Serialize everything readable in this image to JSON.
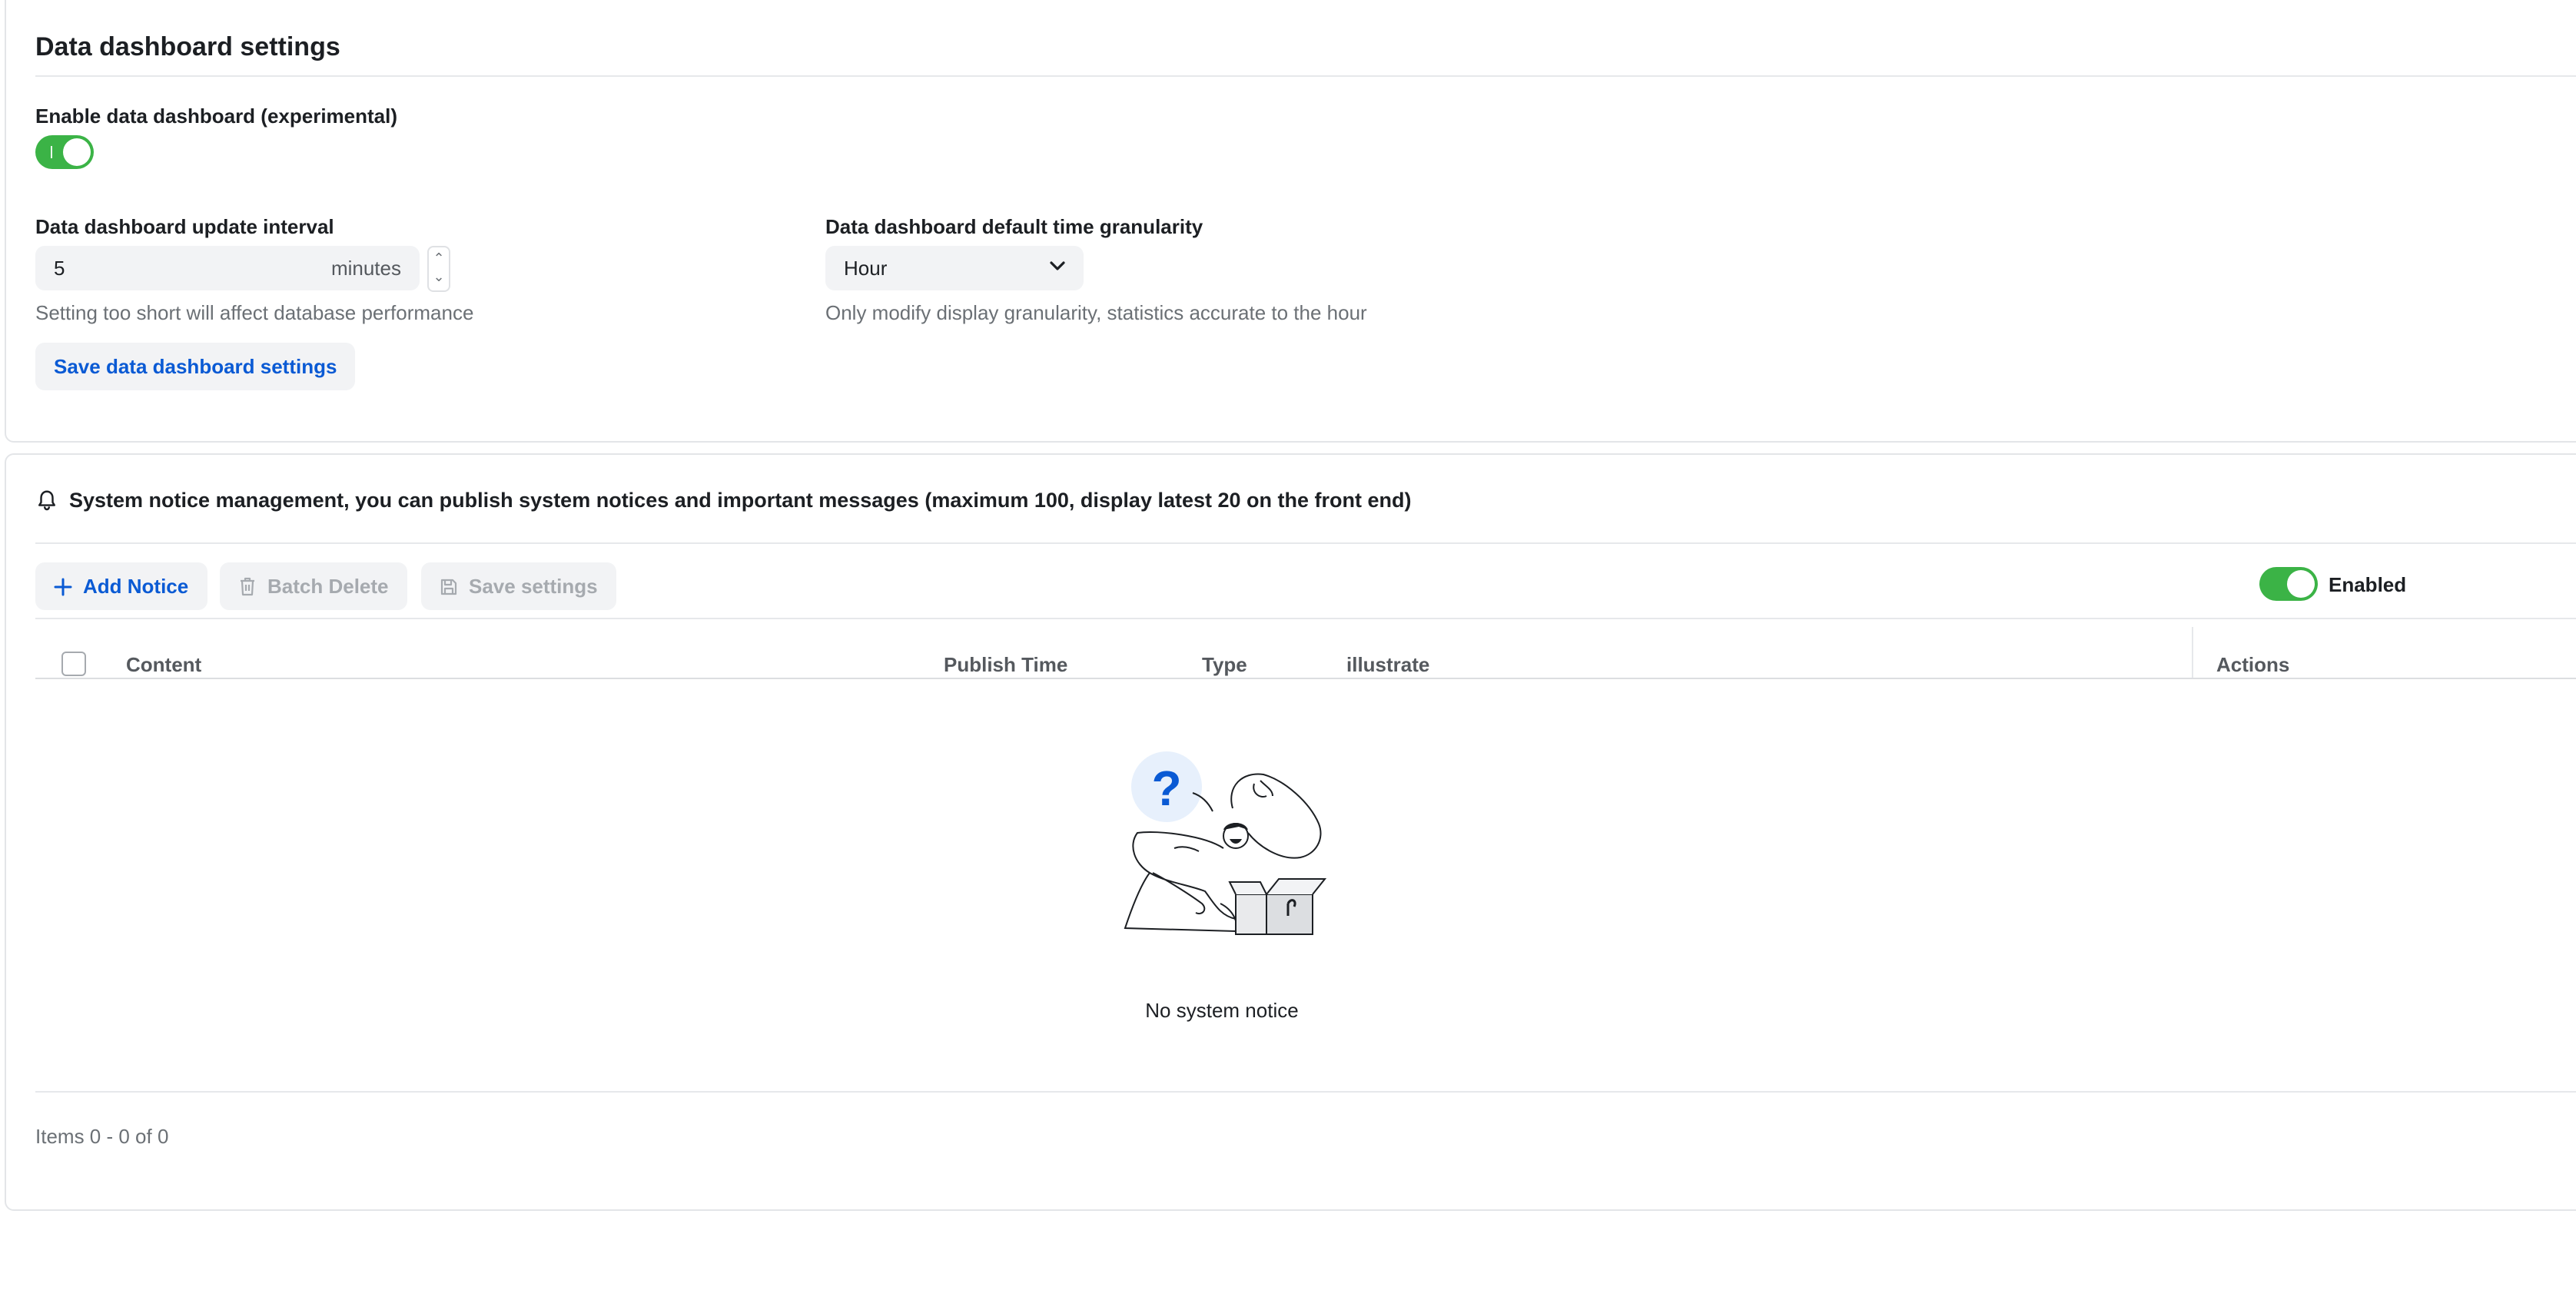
{
  "dashboard": {
    "title": "Data dashboard settings",
    "enable_label": "Enable data dashboard (experimental)",
    "enable_on": true,
    "interval_label": "Data dashboard update interval",
    "interval_value": "5",
    "interval_unit": "minutes",
    "interval_hint": "Setting too short will affect database performance",
    "granularity_label": "Data dashboard default time granularity",
    "granularity_value": "Hour",
    "granularity_hint": "Only modify display granularity, statistics accurate to the hour",
    "save_label": "Save data dashboard settings"
  },
  "notices": {
    "header_text": "System notice management, you can publish system notices and important messages (maximum 100, display latest 20 on the front end)",
    "add_label": "Add Notice",
    "batch_delete_label": "Batch Delete",
    "save_settings_label": "Save settings",
    "enabled_label": "Enabled",
    "enabled_on": true,
    "columns": [
      "Content",
      "Publish Time",
      "Type",
      "illustrate",
      "Actions"
    ],
    "rows": [],
    "empty_text": "No system notice",
    "pagination_text": "Items 0 - 0 of 0"
  },
  "colors": {
    "accent": "#0a5ad4",
    "toggle_on": "#3bb346"
  },
  "icons": [
    "bell-icon",
    "plus-icon",
    "trash-icon",
    "save-icon",
    "chevron-down-icon",
    "question-icon"
  ]
}
